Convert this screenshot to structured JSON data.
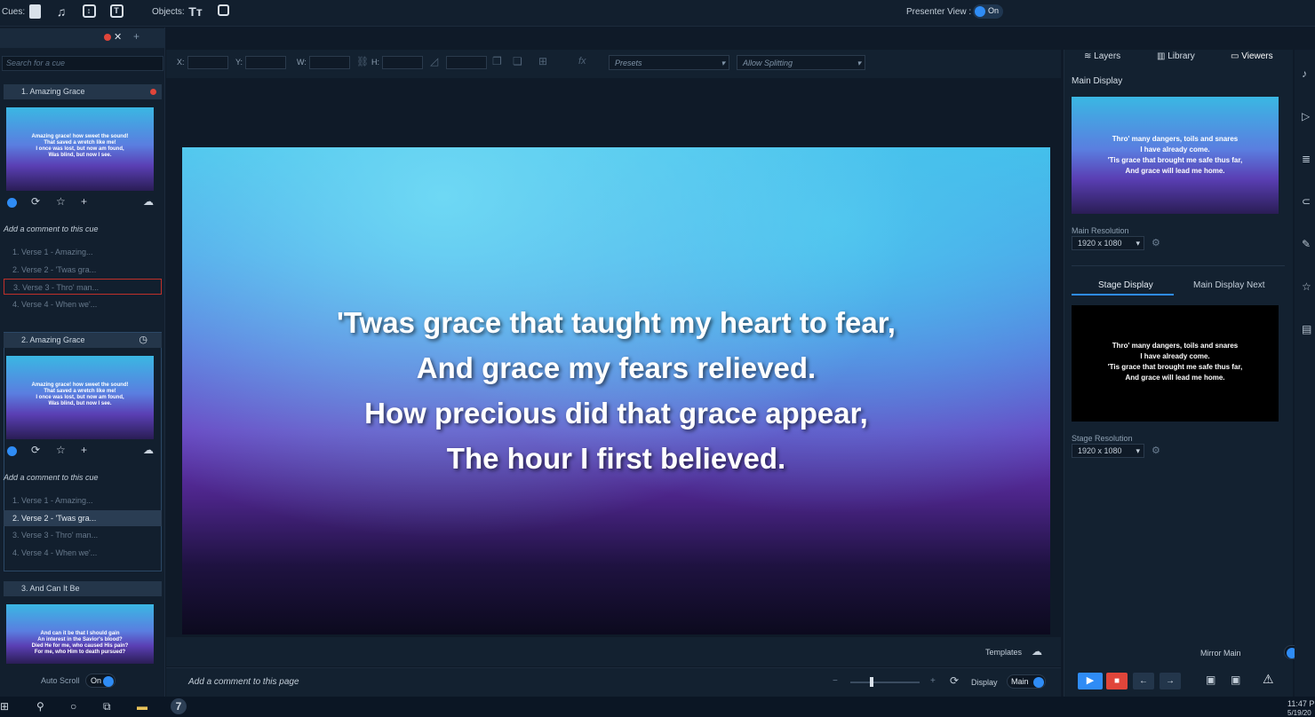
{
  "toolbar": {
    "cues_label": "Cues:",
    "objects_label": "Objects:",
    "presenter_view_label": "Presenter View :",
    "presenter_toggle": "On"
  },
  "left": {
    "search_placeholder": "Search for a cue",
    "cues": [
      {
        "title": "1. Amazing Grace",
        "thumb_lines": [
          "Amazing grace! how sweet the sound!",
          "That saved a wretch like me!",
          "I once was lost, but now am found,",
          "Was blind, but now I see."
        ],
        "comment": "Add a comment to this cue",
        "slides": [
          "1. Verse 1 - Amazing...",
          "2. Verse 2 - 'Twas gra...",
          "3. Verse 3 - Thro' man...",
          "4. Verse 4 - When we'..."
        ]
      },
      {
        "title": "2. Amazing Grace",
        "thumb_lines": [
          "Amazing grace! how sweet the sound!",
          "That saved a wretch like me!",
          "I once was lost, but now am found,",
          "Was blind, but now I see."
        ],
        "comment": "Add a comment to this cue",
        "slides": [
          "1. Verse 1 - Amazing...",
          "2. Verse 2 - 'Twas gra...",
          "3. Verse 3 - Thro' man...",
          "4. Verse 4 - When we'..."
        ]
      },
      {
        "title": "3. And Can It Be",
        "thumb_lines": [
          "And can it be that I should gain",
          "An interest in the Savior's blood?",
          "Died He for me, who caused His pain?",
          "For me, who Him to death pursued?"
        ]
      }
    ],
    "auto_scroll_label": "Auto Scroll",
    "auto_scroll_toggle": "On"
  },
  "editor": {
    "x_label": "X:",
    "y_label": "Y:",
    "w_label": "W:",
    "h_label": "H:",
    "fx_label": "fx",
    "presets": "Presets",
    "splitting": "Allow Splitting",
    "slide_lines": [
      "'Twas grace that taught my heart to fear,",
      "And grace my fears relieved.",
      "How precious did that grace appear,",
      "The hour I first believed."
    ],
    "templates_label": "Templates",
    "page_comment": "Add a comment to this page",
    "display_label": "Display",
    "display_value": "Main"
  },
  "right": {
    "tabs": [
      "Layers",
      "Library",
      "Viewers"
    ],
    "main_display_title": "Main Display",
    "preview_lines": [
      "Thro' many dangers, toils and snares",
      "I have already come.",
      "'Tis grace that brought me safe thus far,",
      "And grace will lead me home."
    ],
    "main_resolution_label": "Main Resolution",
    "main_resolution": "1920 x 1080",
    "subtabs": [
      "Stage Display",
      "Main Display Next"
    ],
    "stage_lines": [
      "Thro' many dangers, toils and snares",
      "I have already come.",
      "'Tis grace that brought me safe thus far,",
      "And grace will lead me home."
    ],
    "stage_resolution_label": "Stage Resolution",
    "stage_resolution": "1920 x 1080",
    "mirror_label": "Mirror Main",
    "mirror_toggle": "No"
  },
  "taskbar": {
    "time": "11:47 P",
    "date": "5/19/20"
  },
  "colors": {
    "accent": "#2f8cf5",
    "stop": "#e0453a",
    "panel": "#132130"
  }
}
